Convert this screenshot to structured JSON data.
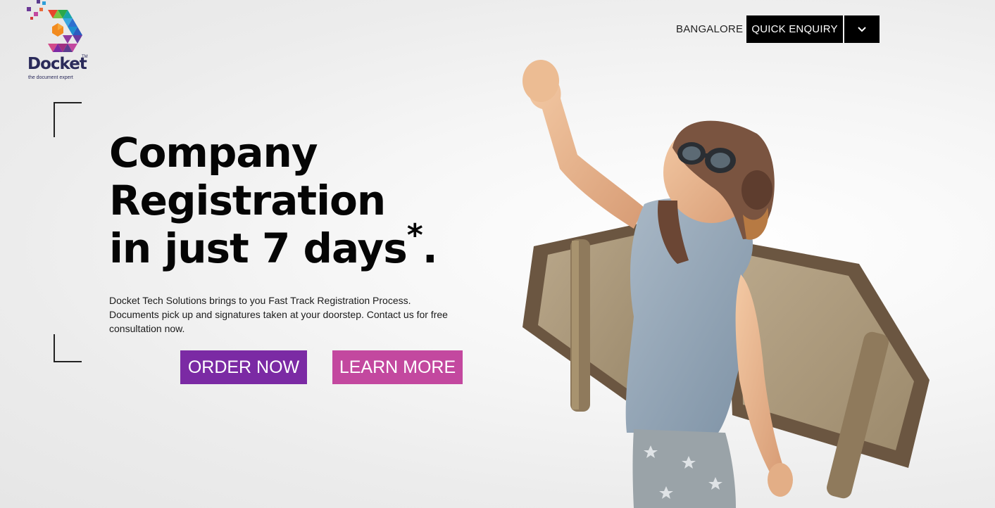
{
  "brand": {
    "name": "Docket",
    "trademark": "TM",
    "tagline": "the document expert"
  },
  "header": {
    "city": "BANGALORE",
    "enquiry_label": "QUICK ENQUIRY",
    "toggle_icon": "chevron-down-icon"
  },
  "hero": {
    "headline_line1": "Company",
    "headline_line2": "Registration",
    "headline_line3": "in just 7 days",
    "headline_asterisk": "*",
    "headline_period": ".",
    "description": "Docket Tech Solutions brings to you Fast Track Registration Process. Documents pick up and signatures taken at your doorstep. Contact us for free consultation now.",
    "order_label": "ORDER NOW",
    "learn_label": "LEARN MORE",
    "image": "child-pilot-with-cardboard-wings"
  },
  "colors": {
    "order_button": "#7b2aa4",
    "learn_button": "#c3489f",
    "enquiry_button": "#000000",
    "logo_primary": "#2a2a5a"
  }
}
